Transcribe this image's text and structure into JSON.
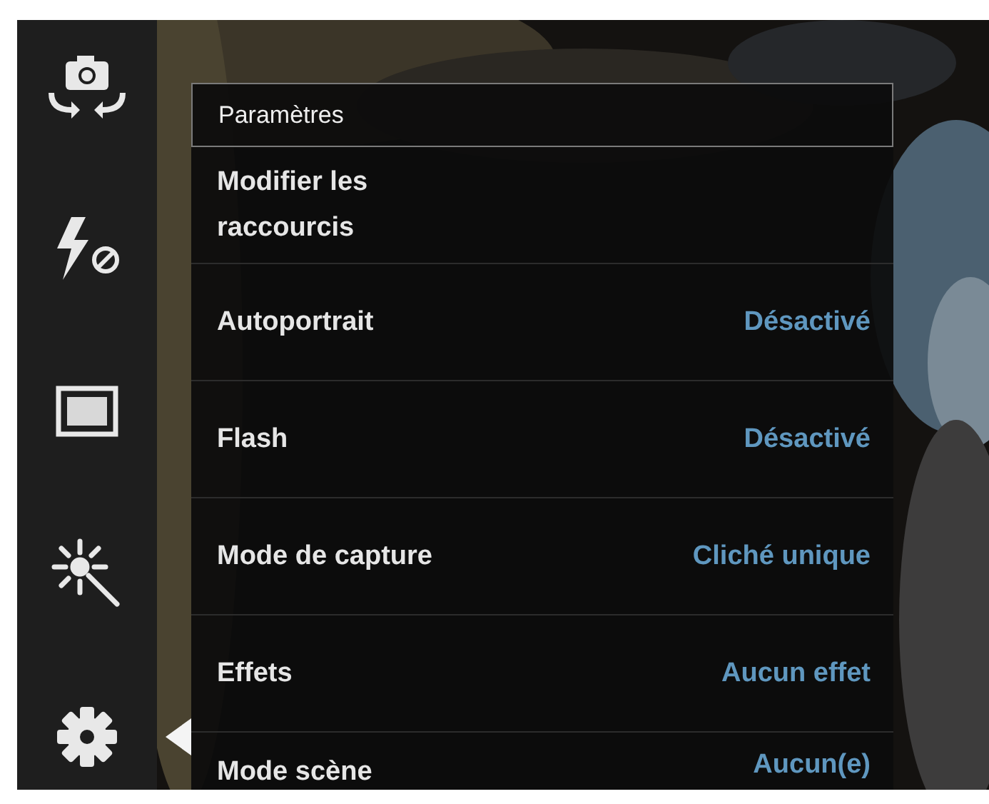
{
  "sidebar": {
    "items": [
      {
        "selected": false
      },
      {
        "selected": false
      },
      {
        "selected": false
      },
      {
        "selected": false
      },
      {
        "selected": true
      }
    ]
  },
  "settings": {
    "title": "Paramètres",
    "rows": [
      {
        "label": "Modifier les raccourcis"
      },
      {
        "label": "Autoportrait",
        "value": "Désactivé"
      },
      {
        "label": "Flash",
        "value": "Désactivé"
      },
      {
        "label": "Mode de capture",
        "value": "Cliché unique"
      },
      {
        "label": "Effets",
        "value": "Aucun effet"
      },
      {
        "label": "Mode scène",
        "value": "Aucun(e)"
      }
    ]
  }
}
